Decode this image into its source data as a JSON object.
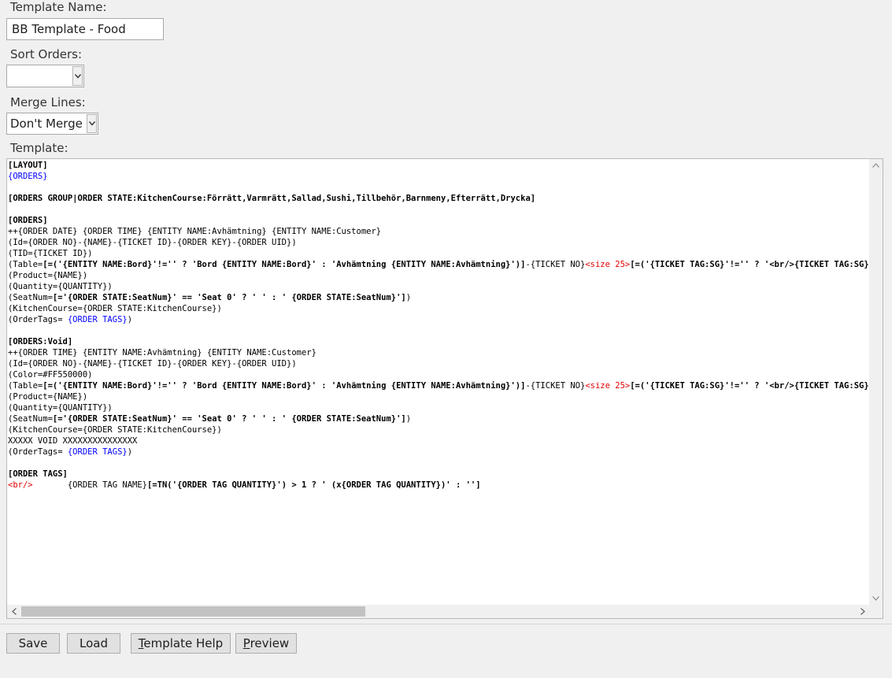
{
  "form": {
    "template_name_label": "Template Name:",
    "template_name_value": "BB Template - Food",
    "sort_orders_label": "Sort Orders:",
    "sort_orders_value": "",
    "merge_lines_label": "Merge Lines:",
    "merge_lines_value": "Don't Merge",
    "template_label": "Template:"
  },
  "editor": {
    "lines": [
      [
        {
          "t": "[LAYOUT]",
          "s": "b"
        }
      ],
      [
        {
          "t": "{ORDERS}",
          "s": "blue"
        }
      ],
      [
        {
          "t": "",
          "s": "n"
        }
      ],
      [
        {
          "t": "[ORDERS GROUP|ORDER STATE:KitchenCourse:Förrätt,Varmrätt,Sallad,Sushi,Tillbehör,Barnmeny,Efterrätt,Drycka]",
          "s": "b"
        }
      ],
      [
        {
          "t": "",
          "s": "n"
        }
      ],
      [
        {
          "t": "[ORDERS]",
          "s": "b"
        }
      ],
      [
        {
          "t": "++{ORDER DATE} {ORDER TIME} {ENTITY NAME:Avhämtning} {ENTITY NAME:Customer}",
          "s": "n"
        }
      ],
      [
        {
          "t": "(Id={ORDER NO}-{NAME}-{TICKET ID}-{ORDER KEY}-{ORDER UID})",
          "s": "n"
        }
      ],
      [
        {
          "t": "(TID={TICKET ID})",
          "s": "n"
        }
      ],
      [
        {
          "t": "(Table=",
          "s": "n"
        },
        {
          "t": "[=('{ENTITY NAME:Bord}'!='' ? 'Bord {ENTITY NAME:Bord}' : 'Avhämtning {ENTITY NAME:Avhämtning}')]",
          "s": "b"
        },
        {
          "t": "-{TICKET NO}",
          "s": "n"
        },
        {
          "t": "<size 25>",
          "s": "red"
        },
        {
          "t": "[=('{TICKET TAG:SG}'!='' ? '<br/>{TICKET TAG:SG}' : '')]",
          "s": "b"
        }
      ],
      [
        {
          "t": "(Product={NAME})",
          "s": "n"
        }
      ],
      [
        {
          "t": "(Quantity={QUANTITY})",
          "s": "n"
        }
      ],
      [
        {
          "t": "(SeatNum=",
          "s": "n"
        },
        {
          "t": "[='{ORDER STATE:SeatNum}' == 'Seat 0' ? ' ' : ' {ORDER STATE:SeatNum}']",
          "s": "b"
        },
        {
          "t": ")",
          "s": "n"
        }
      ],
      [
        {
          "t": "(KitchenCourse={ORDER STATE:KitchenCourse})",
          "s": "n"
        }
      ],
      [
        {
          "t": "(OrderTags= ",
          "s": "n"
        },
        {
          "t": "{ORDER TAGS}",
          "s": "blue"
        },
        {
          "t": ")",
          "s": "n"
        }
      ],
      [
        {
          "t": "",
          "s": "n"
        }
      ],
      [
        {
          "t": "[ORDERS:Void]",
          "s": "b"
        }
      ],
      [
        {
          "t": "++{ORDER TIME} {ENTITY NAME:Avhämtning} {ENTITY NAME:Customer}",
          "s": "n"
        }
      ],
      [
        {
          "t": "(Id={ORDER NO}-{NAME}-{TICKET ID}-{ORDER KEY}-{ORDER UID})",
          "s": "n"
        }
      ],
      [
        {
          "t": "(Color=#FF550000)",
          "s": "n"
        }
      ],
      [
        {
          "t": "(Table=",
          "s": "n"
        },
        {
          "t": "[=('{ENTITY NAME:Bord}'!='' ? 'Bord {ENTITY NAME:Bord}' : 'Avhämtning {ENTITY NAME:Avhämtning}')]",
          "s": "b"
        },
        {
          "t": "-{TICKET NO}",
          "s": "n"
        },
        {
          "t": "<size 25>",
          "s": "red"
        },
        {
          "t": "[=('{TICKET TAG:SG}'!='' ? '<br/>{TICKET TAG:SG}' : '')]",
          "s": "b"
        }
      ],
      [
        {
          "t": "(Product={NAME})",
          "s": "n"
        }
      ],
      [
        {
          "t": "(Quantity={QUANTITY})",
          "s": "n"
        }
      ],
      [
        {
          "t": "(SeatNum=",
          "s": "n"
        },
        {
          "t": "[='{ORDER STATE:SeatNum}' == 'Seat 0' ? ' ' : ' {ORDER STATE:SeatNum}']",
          "s": "b"
        },
        {
          "t": ")",
          "s": "n"
        }
      ],
      [
        {
          "t": "(KitchenCourse={ORDER STATE:KitchenCourse})",
          "s": "n"
        }
      ],
      [
        {
          "t": "XXXXX VOID XXXXXXXXXXXXXXX",
          "s": "n"
        }
      ],
      [
        {
          "t": "(OrderTags= ",
          "s": "n"
        },
        {
          "t": "{ORDER TAGS}",
          "s": "blue"
        },
        {
          "t": ")",
          "s": "n"
        }
      ],
      [
        {
          "t": "",
          "s": "n"
        }
      ],
      [
        {
          "t": "[ORDER TAGS]",
          "s": "b"
        }
      ],
      [
        {
          "t": "<br/>",
          "s": "red"
        },
        {
          "t": "       {ORDER TAG NAME}",
          "s": "n"
        },
        {
          "t": "[=TN('{ORDER TAG QUANTITY}') > 1 ? ' (x{ORDER TAG QUANTITY})' : '']",
          "s": "b"
        }
      ]
    ]
  },
  "buttons": {
    "save": "Save",
    "load": "Load",
    "template_help": "Template Help",
    "preview": "Preview"
  },
  "icons": {
    "combo_arrow": "chevron-down-icon",
    "scroll_up": "arrow-up-icon",
    "scroll_down": "arrow-down-icon",
    "scroll_left": "arrow-left-icon",
    "scroll_right": "arrow-right-icon"
  },
  "colors": {
    "keyword_blue": "#0000ff",
    "markup_red": "#e00000"
  }
}
